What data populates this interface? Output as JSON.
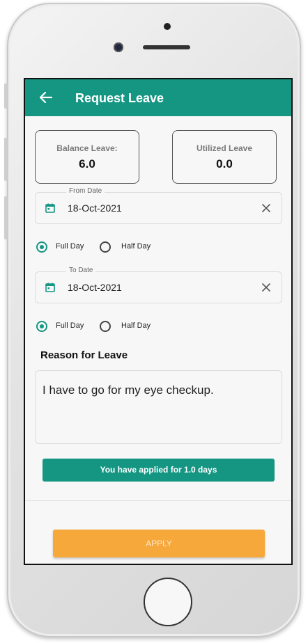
{
  "appbar": {
    "title": "Request Leave"
  },
  "balance": {
    "label": "Balance Leave:",
    "value": "6.0"
  },
  "utilized": {
    "label": "Utilized Leave",
    "value": "0.0"
  },
  "from_date": {
    "legend": "From Date",
    "value": "18-Oct-2021"
  },
  "from_day": {
    "full_day_label": "Full Day",
    "half_day_label": "Half Day",
    "selected": "Full Day"
  },
  "to_date": {
    "legend": "To Date",
    "value": "18-Oct-2021"
  },
  "to_day": {
    "full_day_label": "Full Day",
    "half_day_label": "Half Day",
    "selected": "Full Day"
  },
  "reason": {
    "title": "Reason for Leave",
    "value": "I have to go for my eye checkup."
  },
  "summary": {
    "text": "You have applied for 1.0 days"
  },
  "apply_button": {
    "label": "APPLY"
  },
  "colors": {
    "primary": "#149683",
    "accent": "#f6a83a"
  },
  "icons": {
    "back": "arrow-left-icon",
    "calendar": "calendar-icon",
    "clear": "close-icon"
  }
}
